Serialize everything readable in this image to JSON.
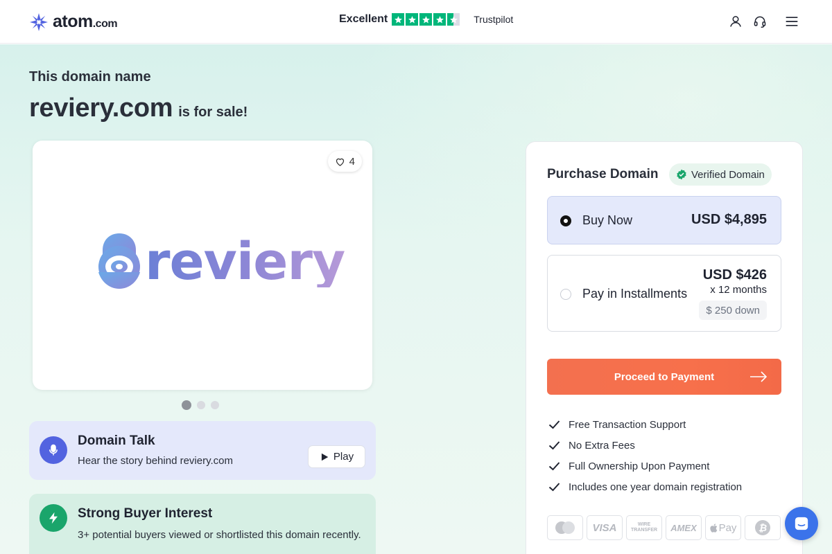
{
  "header": {
    "logo_text": "atom",
    "logo_suffix": ".com",
    "trust_rating_label": "Excellent",
    "trust_rating_stars": 4.5,
    "trust_brand": "Trustpilot",
    "icons": [
      "user-icon",
      "headset-icon",
      "menu-icon"
    ]
  },
  "hero": {
    "subtitle": "This domain name",
    "domain": "reviery.com",
    "for_sale": "is for sale!"
  },
  "preview": {
    "likes": "4",
    "brand_text": "reviery",
    "carousel_dots": 3,
    "active_dot": 0
  },
  "domain_talk": {
    "title": "Domain Talk",
    "subtitle": "Hear the story behind reviery.com",
    "play_label": "Play"
  },
  "interest": {
    "title": "Strong Buyer Interest",
    "subtitle": "3+ potential buyers viewed or shortlisted this domain recently."
  },
  "purchase": {
    "title": "Purchase Domain",
    "verified_label": "Verified Domain",
    "buy_now": {
      "label": "Buy Now",
      "price": "USD $4,895",
      "selected": true
    },
    "installments": {
      "label": "Pay in Installments",
      "price": "USD $426",
      "months": "x 12 months",
      "down": "$ 250 down",
      "selected": false
    },
    "proceed_label": "Proceed to Payment",
    "features": [
      "Free Transaction Support",
      "No Extra Fees",
      "Full Ownership Upon Payment",
      "Includes one year domain registration"
    ],
    "payment_methods": [
      {
        "name": "mastercard-icon",
        "label": ""
      },
      {
        "name": "visa-icon",
        "label": "VISA"
      },
      {
        "name": "wire-transfer-icon",
        "label": "WIRE TRANSFER"
      },
      {
        "name": "amex-icon",
        "label": "AMEX"
      },
      {
        "name": "apple-pay-icon",
        "label": "Pay"
      },
      {
        "name": "bitcoin-icon",
        "label": ""
      }
    ]
  },
  "colors": {
    "accent": "#f3704f",
    "trustpilot_green": "#00b67a",
    "talk_blue": "#5263e0",
    "interest_green": "#1aa56b",
    "chat_blue": "#3b73ea"
  }
}
